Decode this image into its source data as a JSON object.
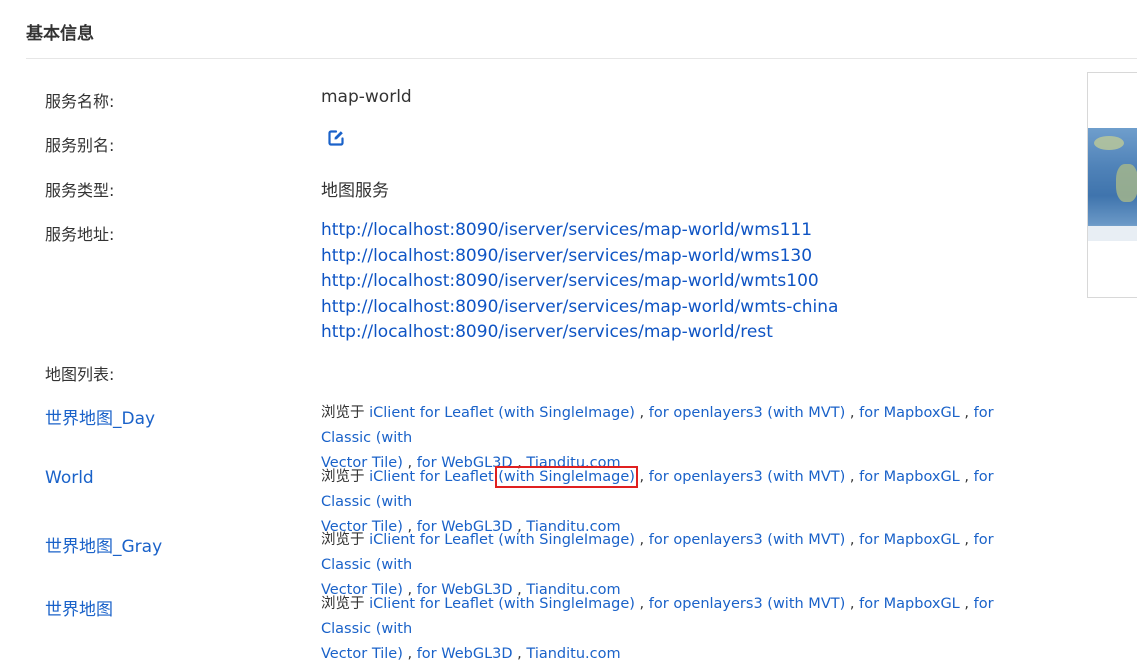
{
  "section": {
    "title": "基本信息"
  },
  "service": {
    "name_label": "服务名称:",
    "name_value": "map-world",
    "alias_label": "服务别名:",
    "type_label": "服务类型:",
    "type_value": "地图服务",
    "address_label": "服务地址:",
    "addresses": [
      "http://localhost:8090/iserver/services/map-world/wms111",
      "http://localhost:8090/iserver/services/map-world/wms130",
      "http://localhost:8090/iserver/services/map-world/wmts100",
      "http://localhost:8090/iserver/services/map-world/wmts-china",
      "http://localhost:8090/iserver/services/map-world/rest"
    ],
    "map_list_label": "地图列表:"
  },
  "browse": {
    "prefix": "浏览于",
    "leaflet": "iClient for Leaflet",
    "singleimage": "(with SingleImage)",
    "openlayers": "for openlayers3 (with MVT)",
    "mapboxgl": "for MapboxGL",
    "classic_1": "for Classic (with",
    "classic_2": "Vector Tile)",
    "webgl3d": "for WebGL3D",
    "tianditu": "Tianditu.com"
  },
  "maps": [
    {
      "name": "世界地图_Day"
    },
    {
      "name": "World"
    },
    {
      "name": "世界地图_Gray"
    },
    {
      "name": "世界地图"
    }
  ],
  "icons": {
    "edit": "edit-icon"
  },
  "colors": {
    "link": "#0e54c4",
    "highlight": "#e02020"
  }
}
